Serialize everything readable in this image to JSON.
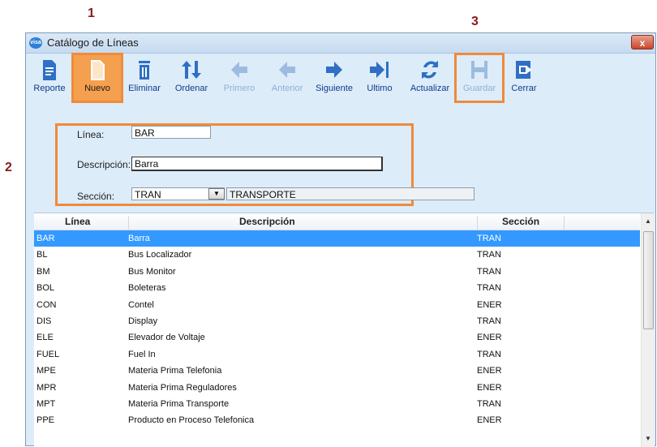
{
  "step_markers": {
    "nuevo": "1",
    "form": "2",
    "guardar": "3"
  },
  "window": {
    "title": "Catálogo de Líneas",
    "app_icon_text": "visa",
    "close_label": "x"
  },
  "toolbar": {
    "reporte": "Reporte",
    "nuevo": "Nuevo",
    "eliminar": "Eliminar",
    "ordenar": "Ordenar",
    "primero": "Primero",
    "anterior": "Anterior",
    "siguiente": "Siguiente",
    "ultimo": "Ultimo",
    "actualizar": "Actualizar",
    "guardar": "Guardar",
    "cerrar": "Cerrar"
  },
  "form": {
    "linea_label": "Línea:",
    "linea_value": "BAR",
    "descripcion_label": "Descripción:",
    "descripcion_value": "Barra",
    "seccion_label": "Sección:",
    "seccion_value": "TRAN",
    "seccion_desc": "TRANSPORTE"
  },
  "grid": {
    "headers": {
      "linea": "Línea",
      "descripcion": "Descripción",
      "seccion": "Sección"
    },
    "rows": [
      {
        "linea": "BAR",
        "descripcion": "Barra",
        "seccion": "TRAN"
      },
      {
        "linea": "BL",
        "descripcion": "Bus Localizador",
        "seccion": "TRAN"
      },
      {
        "linea": "BM",
        "descripcion": "Bus Monitor",
        "seccion": "TRAN"
      },
      {
        "linea": "BOL",
        "descripcion": "Boleteras",
        "seccion": "TRAN"
      },
      {
        "linea": "CON",
        "descripcion": "Contel",
        "seccion": "ENER"
      },
      {
        "linea": "DIS",
        "descripcion": "Display",
        "seccion": "TRAN"
      },
      {
        "linea": "ELE",
        "descripcion": "Elevador de Voltaje",
        "seccion": "ENER"
      },
      {
        "linea": "FUEL",
        "descripcion": "Fuel In",
        "seccion": "TRAN"
      },
      {
        "linea": "MPE",
        "descripcion": "Materia Prima Telefonia",
        "seccion": "ENER"
      },
      {
        "linea": "MPR",
        "descripcion": "Materia Prima Reguladores",
        "seccion": "ENER"
      },
      {
        "linea": "MPT",
        "descripcion": "Materia Prima Transporte",
        "seccion": "TRAN"
      },
      {
        "linea": "PPE",
        "descripcion": "Producto en Proceso Telefonica",
        "seccion": "ENER"
      }
    ]
  },
  "colors": {
    "highlight": "#ef8a3c",
    "selected_row": "#3399ff",
    "window_bg": "#dcecf9",
    "toolbar_label": "#103a8c"
  }
}
